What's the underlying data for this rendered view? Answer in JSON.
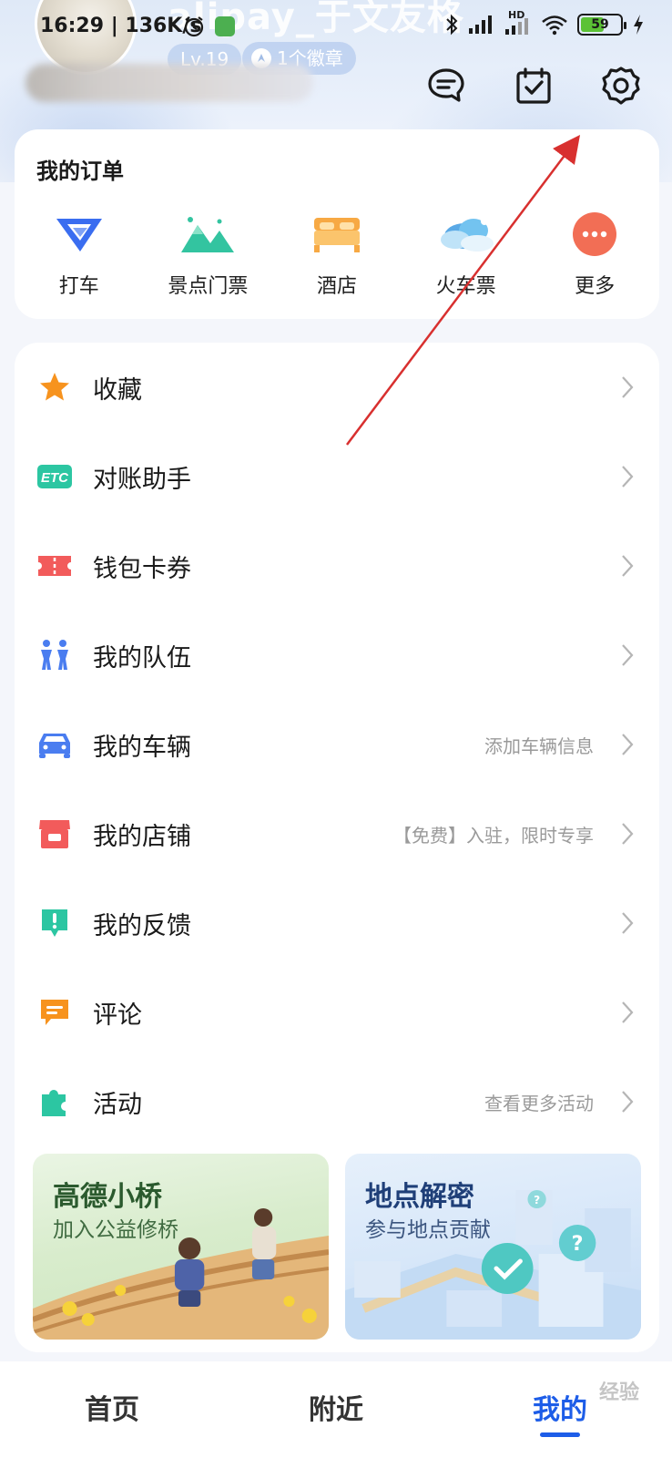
{
  "status_bar": {
    "time_speed": "16:29 | 136K/s",
    "network_tag": "HD",
    "battery_level": "59",
    "battery_fraction": 0.59
  },
  "profile": {
    "name": "alipay_于文友格",
    "level": "Lv.19",
    "badge": "1个徽章"
  },
  "header_actions": {
    "message_icon": "chat-bubble-icon",
    "checkin_icon": "calendar-check-icon",
    "settings_icon": "gear-icon"
  },
  "orders": {
    "title": "我的订单",
    "items": [
      {
        "label": "打车",
        "icon": "taxi-icon",
        "color": "#3a6df0"
      },
      {
        "label": "景点门票",
        "icon": "mountain-icon",
        "color": "#33c4a0"
      },
      {
        "label": "酒店",
        "icon": "bed-icon",
        "color": "#f7a944"
      },
      {
        "label": "火车票",
        "icon": "cloud-icon",
        "color": "#5aa9e6"
      },
      {
        "label": "更多",
        "icon": "more-dots-icon",
        "color": "#f26e55"
      }
    ]
  },
  "menu": {
    "items": [
      {
        "label": "收藏",
        "hint": "",
        "icon": "star-icon",
        "color": "#f7931e"
      },
      {
        "label": "对账助手",
        "hint": "",
        "icon": "etc-icon",
        "color": "#2cc6a2"
      },
      {
        "label": "钱包卡券",
        "hint": "",
        "icon": "ticket-icon",
        "color": "#f25b5b"
      },
      {
        "label": "我的队伍",
        "hint": "",
        "icon": "team-icon",
        "color": "#4a7df0"
      },
      {
        "label": "我的车辆",
        "hint": "添加车辆信息",
        "icon": "car-icon",
        "color": "#4a7df0"
      },
      {
        "label": "我的店铺",
        "hint": "【免费】入驻，限时专享",
        "icon": "shop-icon",
        "color": "#f25b5b"
      },
      {
        "label": "我的反馈",
        "hint": "",
        "icon": "feedback-icon",
        "color": "#2cc6a2"
      },
      {
        "label": "评论",
        "hint": "",
        "icon": "comment-icon",
        "color": "#f7931e"
      },
      {
        "label": "活动",
        "hint": "查看更多活动",
        "icon": "puzzle-icon",
        "color": "#2cc6a2"
      }
    ]
  },
  "promos": [
    {
      "title": "高德小桥",
      "subtitle": "加入公益修桥"
    },
    {
      "title": "地点解密",
      "subtitle": "参与地点贡献"
    }
  ],
  "bottom_nav": {
    "items": [
      {
        "label": "首页",
        "active": false
      },
      {
        "label": "附近",
        "active": false
      },
      {
        "label": "我的",
        "active": true
      }
    ]
  },
  "watermark": "经验",
  "colors": {
    "accent": "#1d5de8",
    "annotation_arrow": "#d8302f"
  }
}
